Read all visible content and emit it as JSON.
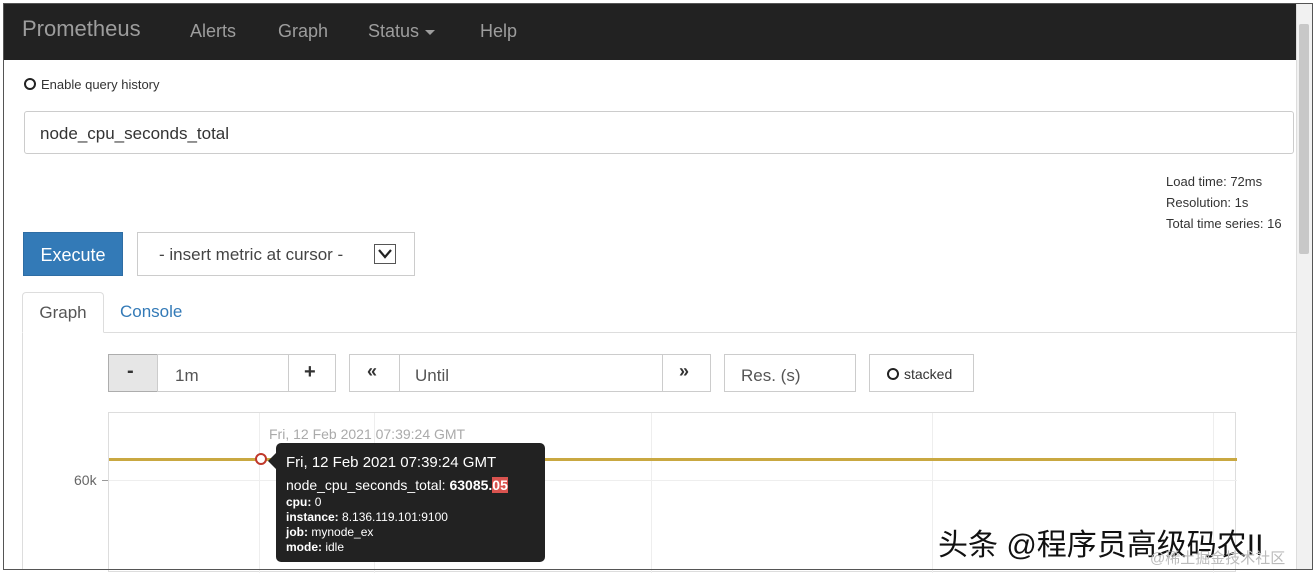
{
  "navbar": {
    "brand": "Prometheus",
    "items": [
      {
        "label": "Alerts"
      },
      {
        "label": "Graph"
      },
      {
        "label": "Status"
      },
      {
        "label": "Help"
      }
    ]
  },
  "query_history": {
    "label": "Enable query history",
    "checked": false
  },
  "expression": {
    "value": "node_cpu_seconds_total"
  },
  "stats": {
    "load_time": "Load time: 72ms",
    "resolution": "Resolution: 1s",
    "total_series": "Total time series: 16"
  },
  "execute_label": "Execute",
  "metric_select": {
    "value": "- insert metric at cursor -"
  },
  "tabs": [
    {
      "label": "Graph",
      "active": true
    },
    {
      "label": "Console",
      "active": false
    }
  ],
  "controls": {
    "minus": "-",
    "range": "1m",
    "plus": "+",
    "back": "«",
    "until_placeholder": "Until",
    "forward": "»",
    "res_placeholder": "Res. (s)",
    "stacked_label": "stacked"
  },
  "graph": {
    "hover_time": "Fri, 12 Feb 2021 07:39:24 GMT",
    "y_tick": "60k",
    "series_color": "#c9a841"
  },
  "tooltip": {
    "time": "Fri, 12 Feb 2021 07:39:24 GMT",
    "metric": "node_cpu_seconds_total:",
    "value_main": "63085.",
    "value_highlight": "05",
    "labels": [
      {
        "key": "cpu:",
        "value": "0"
      },
      {
        "key": "instance:",
        "value": "8.136.119.101:9100"
      },
      {
        "key": "job:",
        "value": "mynode_ex"
      },
      {
        "key": "mode:",
        "value": "idle"
      }
    ]
  },
  "watermark": {
    "main": "头条 @程序员高级码农II",
    "sub": "@稀土掘金技术社区"
  }
}
